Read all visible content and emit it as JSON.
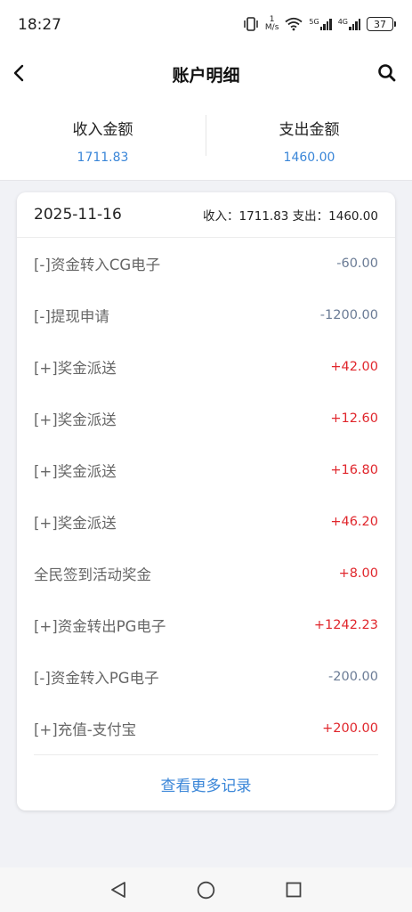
{
  "status_bar": {
    "time": "18:27",
    "network_speed_top": "1",
    "network_speed_unit": "M/s",
    "sig1_label": "5G",
    "sig2_label": "4G",
    "battery": "37"
  },
  "nav": {
    "title": "账户明细",
    "back_icon": "chevron-left-icon",
    "search_icon": "search-icon"
  },
  "summary": {
    "income_label": "收入金额",
    "income_value": "1711.83",
    "expense_label": "支出金额",
    "expense_value": "1460.00"
  },
  "card": {
    "date": "2025-11-16",
    "totals": "收入：1711.83 支出：1460.00",
    "rows": [
      {
        "label": "[-]资金转入CG电子",
        "amount": "-60.00",
        "type": "neg"
      },
      {
        "label": "[-]提现申请",
        "amount": "-1200.00",
        "type": "neg"
      },
      {
        "label": "[+]奖金派送",
        "amount": "+42.00",
        "type": "pos"
      },
      {
        "label": "[+]奖金派送",
        "amount": "+12.60",
        "type": "pos"
      },
      {
        "label": "[+]奖金派送",
        "amount": "+16.80",
        "type": "pos"
      },
      {
        "label": "[+]奖金派送",
        "amount": "+46.20",
        "type": "pos"
      },
      {
        "label": "全民签到活动奖金",
        "amount": "+8.00",
        "type": "pos"
      },
      {
        "label": "[+]资金转出PG电子",
        "amount": "+1242.23",
        "type": "pos"
      },
      {
        "label": "[-]资金转入PG电子",
        "amount": "-200.00",
        "type": "neg"
      },
      {
        "label": "[+]充值-支付宝",
        "amount": "+200.00",
        "type": "pos"
      }
    ],
    "more_label": "查看更多记录"
  },
  "colors": {
    "accent_blue": "#3a86d8",
    "positive_red": "#e0262c",
    "negative_gray_blue": "#6a7b95"
  }
}
